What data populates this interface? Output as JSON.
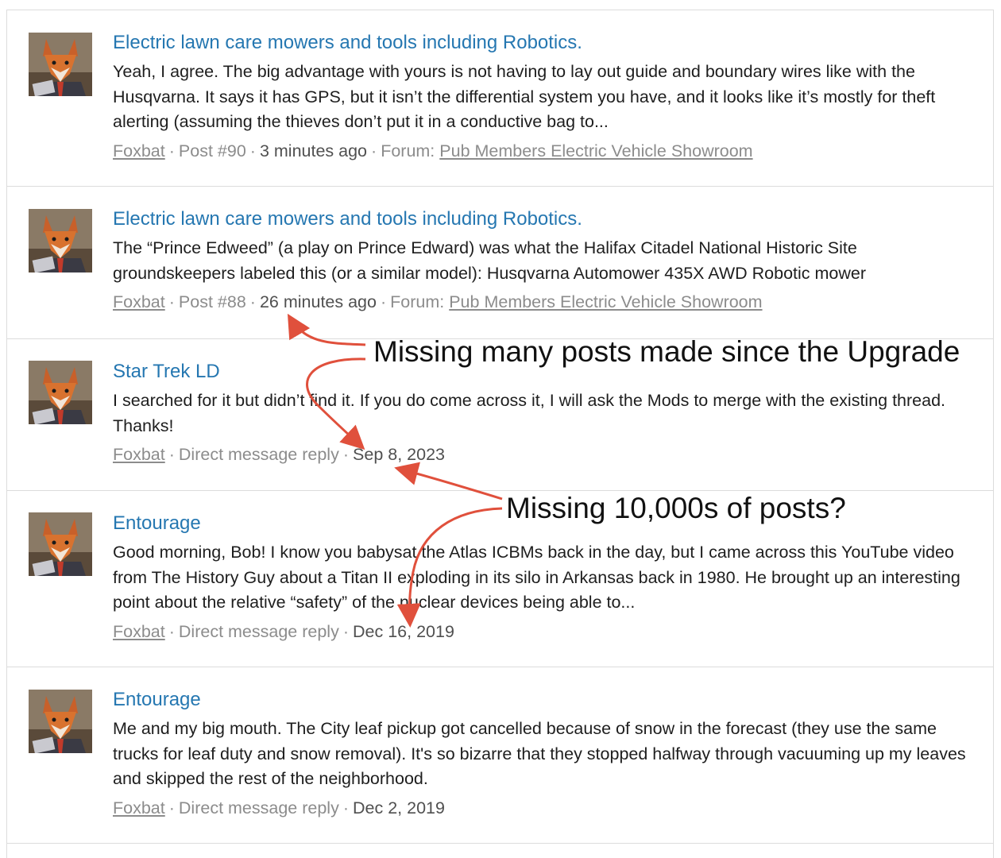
{
  "posts": [
    {
      "title": "Electric lawn care mowers and tools including Robotics.",
      "snippet": "Yeah, I agree. The big advantage with yours is not having to lay out guide and boundary wires like with the Husqvarna. It says it has GPS, but it isn’t the differential system you have, and it looks like it’s mostly for theft alerting (assuming the thieves don’t put it in a conductive bag to...",
      "user": "Foxbat",
      "type": "Post #90",
      "time": "3 minutes ago",
      "forum_label": "Forum:",
      "forum": "Pub Members Electric Vehicle Showroom"
    },
    {
      "title": "Electric lawn care mowers and tools including Robotics.",
      "snippet": "The “Prince Edweed” (a play on Prince Edward) was what the Halifax Citadel National Historic Site groundskeepers labeled this (or a similar model): Husqvarna Automower 435X AWD Robotic mower",
      "user": "Foxbat",
      "type": "Post #88",
      "time": "26 minutes ago",
      "forum_label": "Forum:",
      "forum": "Pub Members Electric Vehicle Showroom"
    },
    {
      "title": "Star Trek LD",
      "snippet": "I searched for it but didn’t find it. If you do come across it, I will ask the Mods to merge with the existing thread. Thanks!",
      "user": "Foxbat",
      "type": "Direct message reply",
      "time": "Sep 8, 2023"
    },
    {
      "title": "Entourage",
      "snippet": "Good morning, Bob! I know you babysat the Atlas ICBMs back in the day, but I came across this YouTube video from The History Guy about a Titan II exploding in its silo in Arkansas back in 1980. He brought up an interesting point about the relative “safety” of the nuclear devices being able to...",
      "user": "Foxbat",
      "type": "Direct message reply",
      "time": "Dec 16, 2019"
    },
    {
      "title": "Entourage",
      "snippet": "Me and my big mouth. The City leaf pickup got cancelled because of snow in the forecast (they use the same trucks for leaf duty and snow removal). It's so bizarre that they stopped halfway through vacuuming up my leaves and skipped the rest of the neighborhood.",
      "user": "Foxbat",
      "type": "Direct message reply",
      "time": "Dec 2, 2019"
    }
  ],
  "meta_separator": "·",
  "annotations": {
    "upgrade_note": "Missing many posts made since the Upgrade",
    "count_note": "Missing 10,000s of posts?"
  },
  "colors": {
    "link": "#2577b1",
    "meta": "#8c8c8c",
    "arrow": "#e0503c",
    "divider": "#dcdcdc"
  },
  "icons": {
    "avatar": "fox-avatar-icon"
  }
}
